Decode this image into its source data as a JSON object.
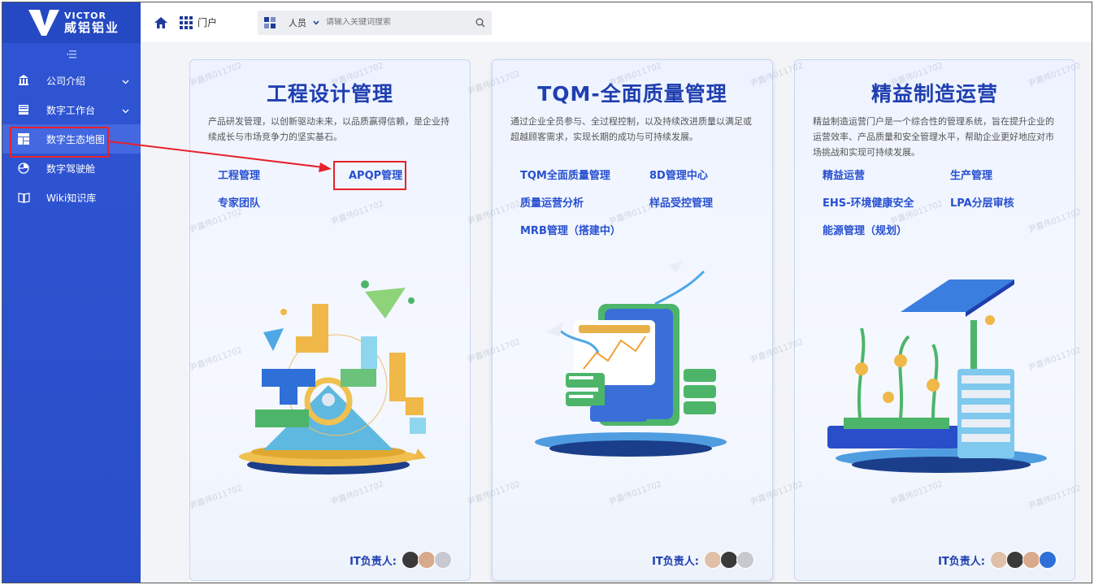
{
  "logo": {
    "en": "VICTOR",
    "cn": "威铝铝业"
  },
  "sidebar": {
    "items": [
      {
        "label": "公司介绍",
        "icon": "building-icon",
        "has_children": true
      },
      {
        "label": "数字工作台",
        "icon": "desk-icon",
        "has_children": true
      },
      {
        "label": "数字生态地图",
        "icon": "layout-icon",
        "has_children": false
      },
      {
        "label": "数字驾驶舱",
        "icon": "dashboard-icon",
        "has_children": false
      },
      {
        "label": "Wiki知识库",
        "icon": "book-icon",
        "has_children": false
      }
    ],
    "active_index": 2
  },
  "topbar": {
    "portal_label": "门户",
    "search_scope": "人员",
    "search_placeholder": "请输入关键词搜索"
  },
  "cards": [
    {
      "title": "工程设计管理",
      "desc": "产品研发管理，以创新驱动未来，以品质赢得信赖，是企业持续成长与市场竞争力的坚实基石。",
      "links": [
        "工程管理",
        "APQP管理",
        "专家团队"
      ],
      "owner_label": "IT负责人:"
    },
    {
      "title": "TQM-全面质量管理",
      "desc": "通过企业全员参与、全过程控制，以及持续改进质量以满足或超越顾客需求，实现长期的成功与可持续发展。",
      "links": [
        "TQM全面质量管理",
        "8D管理中心",
        "质量运营分析",
        "样品受控管理",
        "MRB管理（搭建中）"
      ],
      "owner_label": "IT负责人:"
    },
    {
      "title": "精益制造运营",
      "desc": "精益制造运营门户是一个综合性的管理系统，旨在提升企业的运营效率、产品质量和安全管理水平，帮助企业更好地应对市场挑战和实现可持续发展。",
      "links": [
        "精益运营",
        "生产管理",
        "EHS-环境健康安全",
        "LPA分层审核",
        "能源管理（规划）"
      ],
      "owner_label": "IT负责人:"
    }
  ],
  "watermark": "尹嘉伟011702",
  "colors": {
    "sidebar": "#2f55d4",
    "accent": "#1f3fb0",
    "link": "#2750d0",
    "highlight": "#e8212b"
  }
}
